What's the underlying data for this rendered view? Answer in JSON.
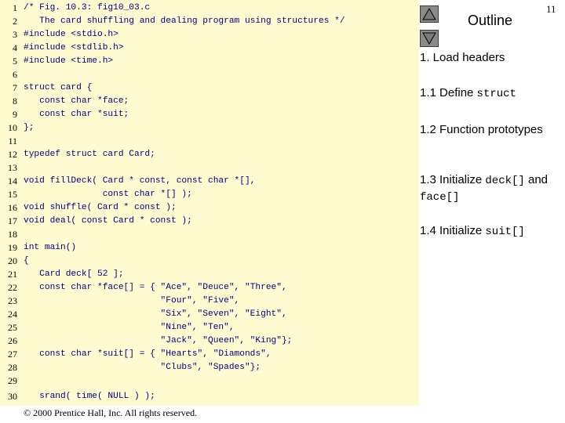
{
  "slide": {
    "page_number": "11",
    "copyright": "© 2000 Prentice Hall, Inc. All rights reserved."
  },
  "sidebar": {
    "title": "Outline",
    "up_icon": "triangle-up-icon",
    "down_icon": "triangle-down-icon",
    "items": [
      {
        "text": "1. Load headers"
      },
      {
        "text": "1.1 Define ",
        "code": "struct"
      },
      {
        "text": "1.2 Function prototypes"
      },
      {
        "text": "1.3 Initialize ",
        "code": "deck[]",
        "text2": " and ",
        "code2": "face[]"
      },
      {
        "text": "1.4 Initialize ",
        "code": "suit[]"
      }
    ]
  },
  "code": {
    "lines": [
      {
        "num": "1",
        "text": "/* Fig. 10.3: fig10_03.c"
      },
      {
        "num": "2",
        "text": "   The card shuffling and dealing program using structures */"
      },
      {
        "num": "3",
        "text": "#include <stdio.h>"
      },
      {
        "num": "4",
        "text": "#include <stdlib.h>"
      },
      {
        "num": "5",
        "text": "#include <time.h>"
      },
      {
        "num": "6",
        "text": ""
      },
      {
        "num": "7",
        "text": "struct card {"
      },
      {
        "num": "8",
        "text": "   const char *face;"
      },
      {
        "num": "9",
        "text": "   const char *suit;"
      },
      {
        "num": "10",
        "text": "};"
      },
      {
        "num": "11",
        "text": ""
      },
      {
        "num": "12",
        "text": "typedef struct card Card;"
      },
      {
        "num": "13",
        "text": ""
      },
      {
        "num": "14",
        "text": "void fillDeck( Card * const, const char *[],"
      },
      {
        "num": "15",
        "text": "               const char *[] );"
      },
      {
        "num": "16",
        "text": "void shuffle( Card * const );"
      },
      {
        "num": "17",
        "text": "void deal( const Card * const );"
      },
      {
        "num": "18",
        "text": ""
      },
      {
        "num": "19",
        "text": "int main()"
      },
      {
        "num": "20",
        "text": "{"
      },
      {
        "num": "21",
        "text": "   Card deck[ 52 ];"
      },
      {
        "num": "22",
        "text": "   const char *face[] = { \"Ace\", \"Deuce\", \"Three\","
      },
      {
        "num": "23",
        "text": "                          \"Four\", \"Five\","
      },
      {
        "num": "24",
        "text": "                          \"Six\", \"Seven\", \"Eight\","
      },
      {
        "num": "25",
        "text": "                          \"Nine\", \"Ten\","
      },
      {
        "num": "26",
        "text": "                          \"Jack\", \"Queen\", \"King\"};"
      },
      {
        "num": "27",
        "text": "   const char *suit[] = { \"Hearts\", \"Diamonds\","
      },
      {
        "num": "28",
        "text": "                          \"Clubs\", \"Spades\"};"
      },
      {
        "num": "29",
        "text": ""
      },
      {
        "num": "30",
        "text": "   srand( time( NULL ) );"
      }
    ]
  }
}
